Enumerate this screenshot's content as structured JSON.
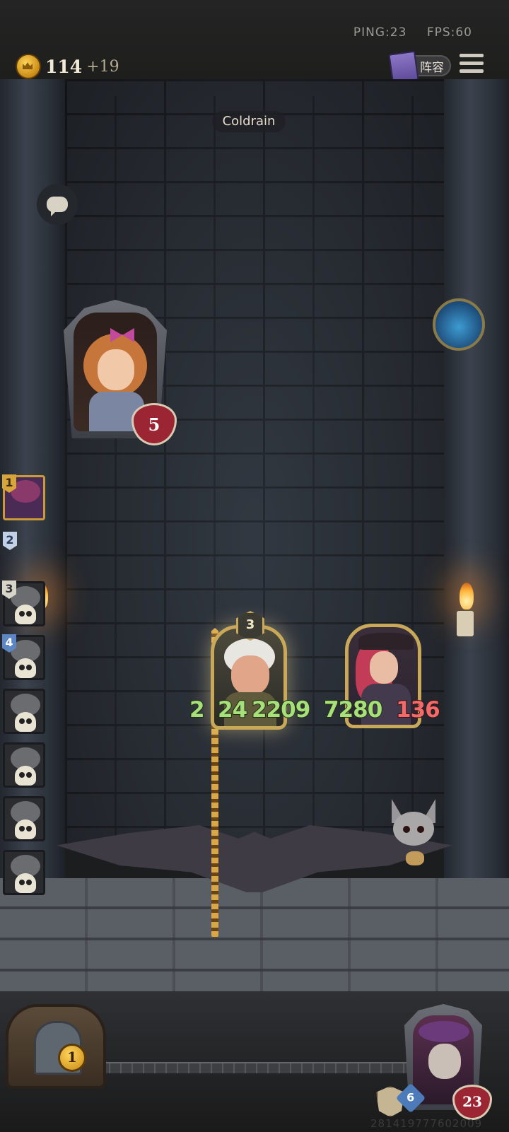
{
  "status": {
    "ping": "PING:23",
    "fps": "FPS:60"
  },
  "gold": {
    "amount": "114",
    "income": "+19"
  },
  "lineup_button": {
    "label": "阵容"
  },
  "opponent": {
    "name": "Coldrain",
    "health": "5"
  },
  "lineup_slots": [
    {
      "number": "1",
      "state": "active"
    },
    {
      "number": "2",
      "state": "empty"
    },
    {
      "number": "3",
      "state": "eliminated"
    },
    {
      "number": "4",
      "state": "eliminated"
    },
    {
      "number": "",
      "state": "eliminated"
    },
    {
      "number": "",
      "state": "eliminated"
    },
    {
      "number": "",
      "state": "eliminated"
    },
    {
      "number": "",
      "state": "eliminated"
    }
  ],
  "battle": {
    "attacker_tier": "3",
    "damage_numbers": [
      "2",
      "24",
      "2209",
      "7280",
      "136"
    ]
  },
  "shop": {
    "refresh_cost": "1"
  },
  "player": {
    "shield": "",
    "attack": "6",
    "health": "23",
    "id": "281419777602009"
  }
}
